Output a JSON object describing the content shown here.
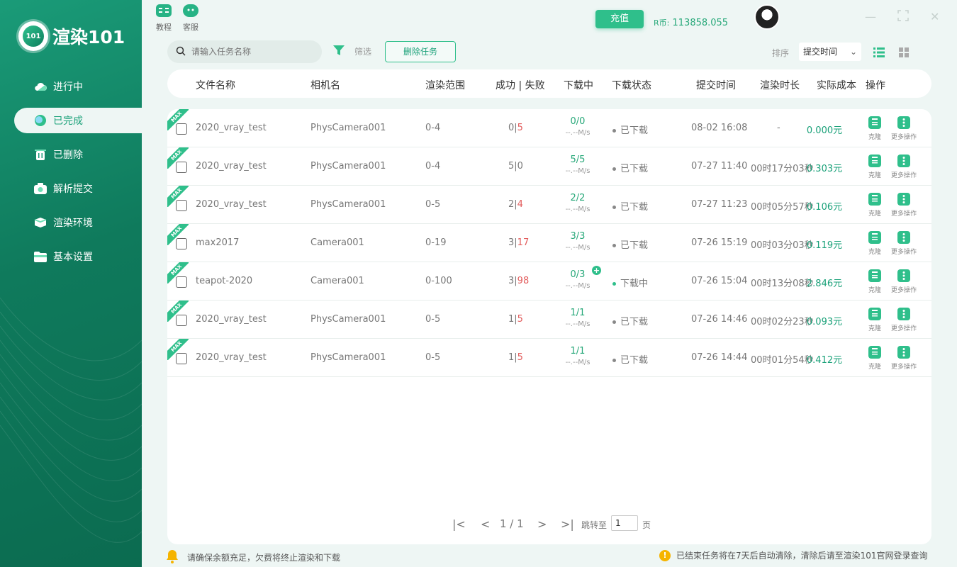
{
  "app": {
    "logo_badge": "101",
    "name": "渲染101"
  },
  "sidebar": {
    "items": [
      {
        "label": "进行中",
        "icon": "cloud-icon"
      },
      {
        "label": "已完成",
        "icon": "check-circle-icon",
        "active": true
      },
      {
        "label": "已删除",
        "icon": "trash-icon"
      },
      {
        "label": "解析提交",
        "icon": "camera-icon"
      },
      {
        "label": "渲染环境",
        "icon": "cube-icon"
      },
      {
        "label": "基本设置",
        "icon": "folder-icon"
      }
    ]
  },
  "topbar": {
    "tutorial": "教程",
    "service": "客服",
    "recharge": "充值",
    "coin_label": "R币:",
    "coin_value": "113858.055"
  },
  "toolbar": {
    "search_placeholder": "请输入任务名称",
    "filter": "筛选",
    "delete": "删除任务",
    "sort_label": "排序",
    "sort_value": "提交时间"
  },
  "table": {
    "headers": [
      "文件名称",
      "相机名",
      "渲染范围",
      "成功 | 失败",
      "下载中",
      "下载状态",
      "提交时间",
      "渲染时长",
      "实际成本",
      "操作"
    ],
    "tag": "MAX",
    "speed": "--.--M/s",
    "action_clone": "克隆",
    "action_more": "更多操作",
    "rows": [
      {
        "file": "2020_vray_test",
        "camera": "PhysCamera001",
        "range": "0-4",
        "success": "0",
        "fail": "5",
        "download": "0/0",
        "status": "已下载",
        "submit": "08-02 16:08",
        "duration": "-",
        "cost": "0.000元"
      },
      {
        "file": "2020_vray_test",
        "camera": "PhysCamera001",
        "range": "0-4",
        "success": "5",
        "fail": "0",
        "download": "5/5",
        "status": "已下载",
        "submit": "07-27 11:40",
        "duration": "00时17分03秒",
        "cost": "0.303元"
      },
      {
        "file": "2020_vray_test",
        "camera": "PhysCamera001",
        "range": "0-5",
        "success": "2",
        "fail": "4",
        "download": "2/2",
        "status": "已下载",
        "submit": "07-27 11:23",
        "duration": "00时05分57秒",
        "cost": "0.106元"
      },
      {
        "file": "max2017",
        "camera": "Camera001",
        "range": "0-19",
        "success": "3",
        "fail": "17",
        "download": "3/3",
        "status": "已下载",
        "submit": "07-26 15:19",
        "duration": "00时03分03秒",
        "cost": "0.119元"
      },
      {
        "file": "teapot-2020",
        "camera": "Camera001",
        "range": "0-100",
        "success": "3",
        "fail": "98",
        "download": "0/3",
        "status": "下载中",
        "submit": "07-26 15:04",
        "duration": "00时13分08秒",
        "cost": "2.846元"
      },
      {
        "file": "2020_vray_test",
        "camera": "PhysCamera001",
        "range": "0-5",
        "success": "1",
        "fail": "5",
        "download": "1/1",
        "status": "已下载",
        "submit": "07-26 14:46",
        "duration": "00时02分23秒",
        "cost": "0.093元"
      },
      {
        "file": "2020_vray_test",
        "camera": "PhysCamera001",
        "range": "0-5",
        "success": "1",
        "fail": "5",
        "download": "1/1",
        "status": "已下载",
        "submit": "07-26 14:44",
        "duration": "00时01分54秒",
        "cost": "0.412元"
      }
    ]
  },
  "pagination": {
    "current": "1 / 1",
    "jump_label": "跳转至",
    "jump_value": "1",
    "page_unit": "页"
  },
  "footer": {
    "left": "请确保余额充足，欠费将终止渲染和下载",
    "right": "已结束任务将在7天后自动清除，清除后请至渲染101官网登录查询"
  },
  "colors": {
    "brand": "#1aa179",
    "accent": "#2fbf8b",
    "fail": "#e25c5c"
  }
}
